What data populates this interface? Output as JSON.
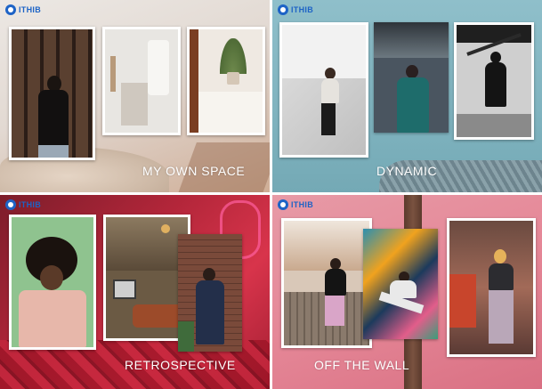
{
  "brand": "ITHIB",
  "panels": [
    {
      "caption": "MY OWN SPACE"
    },
    {
      "caption": "DYNAMIC"
    },
    {
      "caption": "RETROSPECTIVE"
    },
    {
      "caption": "OFF THE WALL"
    }
  ],
  "colors": {
    "brand_blue": "#1d63c6",
    "panel1": "#e2d9d2",
    "panel2": "#7fb3bf",
    "panel3": "#c12b40",
    "panel4": "#e58797"
  }
}
